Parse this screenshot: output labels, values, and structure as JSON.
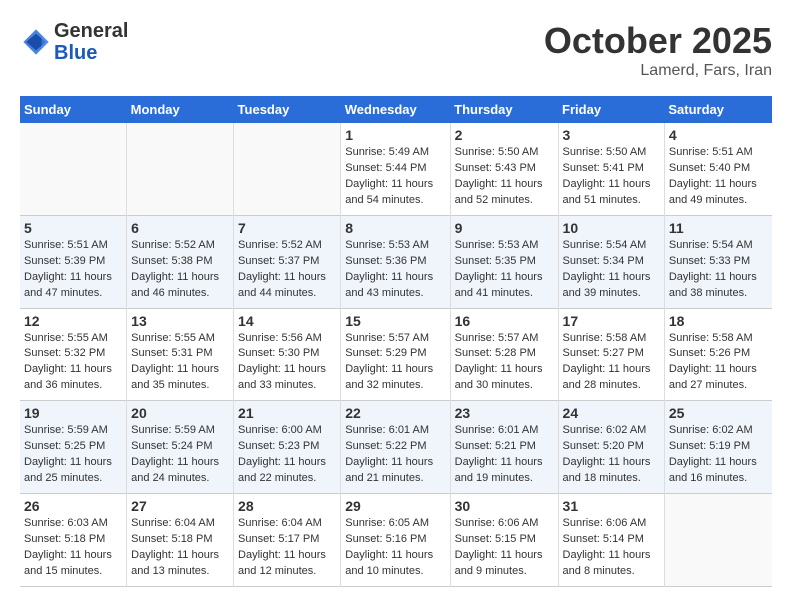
{
  "header": {
    "logo_line1": "General",
    "logo_line2": "Blue",
    "month": "October 2025",
    "location": "Lamerd, Fars, Iran"
  },
  "weekdays": [
    "Sunday",
    "Monday",
    "Tuesday",
    "Wednesday",
    "Thursday",
    "Friday",
    "Saturday"
  ],
  "weeks": [
    [
      {
        "day": "",
        "text": ""
      },
      {
        "day": "",
        "text": ""
      },
      {
        "day": "",
        "text": ""
      },
      {
        "day": "1",
        "text": "Sunrise: 5:49 AM\nSunset: 5:44 PM\nDaylight: 11 hours\nand 54 minutes."
      },
      {
        "day": "2",
        "text": "Sunrise: 5:50 AM\nSunset: 5:43 PM\nDaylight: 11 hours\nand 52 minutes."
      },
      {
        "day": "3",
        "text": "Sunrise: 5:50 AM\nSunset: 5:41 PM\nDaylight: 11 hours\nand 51 minutes."
      },
      {
        "day": "4",
        "text": "Sunrise: 5:51 AM\nSunset: 5:40 PM\nDaylight: 11 hours\nand 49 minutes."
      }
    ],
    [
      {
        "day": "5",
        "text": "Sunrise: 5:51 AM\nSunset: 5:39 PM\nDaylight: 11 hours\nand 47 minutes."
      },
      {
        "day": "6",
        "text": "Sunrise: 5:52 AM\nSunset: 5:38 PM\nDaylight: 11 hours\nand 46 minutes."
      },
      {
        "day": "7",
        "text": "Sunrise: 5:52 AM\nSunset: 5:37 PM\nDaylight: 11 hours\nand 44 minutes."
      },
      {
        "day": "8",
        "text": "Sunrise: 5:53 AM\nSunset: 5:36 PM\nDaylight: 11 hours\nand 43 minutes."
      },
      {
        "day": "9",
        "text": "Sunrise: 5:53 AM\nSunset: 5:35 PM\nDaylight: 11 hours\nand 41 minutes."
      },
      {
        "day": "10",
        "text": "Sunrise: 5:54 AM\nSunset: 5:34 PM\nDaylight: 11 hours\nand 39 minutes."
      },
      {
        "day": "11",
        "text": "Sunrise: 5:54 AM\nSunset: 5:33 PM\nDaylight: 11 hours\nand 38 minutes."
      }
    ],
    [
      {
        "day": "12",
        "text": "Sunrise: 5:55 AM\nSunset: 5:32 PM\nDaylight: 11 hours\nand 36 minutes."
      },
      {
        "day": "13",
        "text": "Sunrise: 5:55 AM\nSunset: 5:31 PM\nDaylight: 11 hours\nand 35 minutes."
      },
      {
        "day": "14",
        "text": "Sunrise: 5:56 AM\nSunset: 5:30 PM\nDaylight: 11 hours\nand 33 minutes."
      },
      {
        "day": "15",
        "text": "Sunrise: 5:57 AM\nSunset: 5:29 PM\nDaylight: 11 hours\nand 32 minutes."
      },
      {
        "day": "16",
        "text": "Sunrise: 5:57 AM\nSunset: 5:28 PM\nDaylight: 11 hours\nand 30 minutes."
      },
      {
        "day": "17",
        "text": "Sunrise: 5:58 AM\nSunset: 5:27 PM\nDaylight: 11 hours\nand 28 minutes."
      },
      {
        "day": "18",
        "text": "Sunrise: 5:58 AM\nSunset: 5:26 PM\nDaylight: 11 hours\nand 27 minutes."
      }
    ],
    [
      {
        "day": "19",
        "text": "Sunrise: 5:59 AM\nSunset: 5:25 PM\nDaylight: 11 hours\nand 25 minutes."
      },
      {
        "day": "20",
        "text": "Sunrise: 5:59 AM\nSunset: 5:24 PM\nDaylight: 11 hours\nand 24 minutes."
      },
      {
        "day": "21",
        "text": "Sunrise: 6:00 AM\nSunset: 5:23 PM\nDaylight: 11 hours\nand 22 minutes."
      },
      {
        "day": "22",
        "text": "Sunrise: 6:01 AM\nSunset: 5:22 PM\nDaylight: 11 hours\nand 21 minutes."
      },
      {
        "day": "23",
        "text": "Sunrise: 6:01 AM\nSunset: 5:21 PM\nDaylight: 11 hours\nand 19 minutes."
      },
      {
        "day": "24",
        "text": "Sunrise: 6:02 AM\nSunset: 5:20 PM\nDaylight: 11 hours\nand 18 minutes."
      },
      {
        "day": "25",
        "text": "Sunrise: 6:02 AM\nSunset: 5:19 PM\nDaylight: 11 hours\nand 16 minutes."
      }
    ],
    [
      {
        "day": "26",
        "text": "Sunrise: 6:03 AM\nSunset: 5:18 PM\nDaylight: 11 hours\nand 15 minutes."
      },
      {
        "day": "27",
        "text": "Sunrise: 6:04 AM\nSunset: 5:18 PM\nDaylight: 11 hours\nand 13 minutes."
      },
      {
        "day": "28",
        "text": "Sunrise: 6:04 AM\nSunset: 5:17 PM\nDaylight: 11 hours\nand 12 minutes."
      },
      {
        "day": "29",
        "text": "Sunrise: 6:05 AM\nSunset: 5:16 PM\nDaylight: 11 hours\nand 10 minutes."
      },
      {
        "day": "30",
        "text": "Sunrise: 6:06 AM\nSunset: 5:15 PM\nDaylight: 11 hours\nand 9 minutes."
      },
      {
        "day": "31",
        "text": "Sunrise: 6:06 AM\nSunset: 5:14 PM\nDaylight: 11 hours\nand 8 minutes."
      },
      {
        "day": "",
        "text": ""
      }
    ]
  ]
}
